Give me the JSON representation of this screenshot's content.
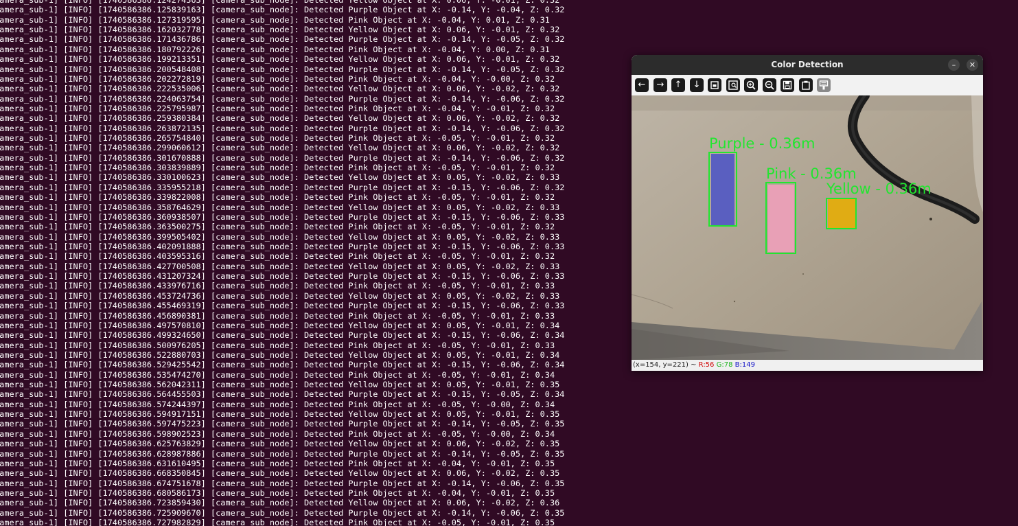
{
  "terminal": {
    "lines": [
      "camera_sub-1] [INFO] [1740586386.124274363] [camera_sub_node]: Detected Yellow Object at X: 0.06, Y: -0.01, Z: 0.32",
      "camera_sub-1] [INFO] [1740586386.125839163] [camera_sub_node]: Detected Purple Object at X: -0.14, Y: -0.04, Z: 0.32",
      "camera_sub-1] [INFO] [1740586386.127319595] [camera_sub_node]: Detected Pink Object at X: -0.04, Y: 0.01, Z: 0.31",
      "camera_sub-1] [INFO] [1740586386.162032778] [camera_sub_node]: Detected Yellow Object at X: 0.06, Y: -0.01, Z: 0.32",
      "camera_sub-1] [INFO] [1740586386.171436786] [camera_sub_node]: Detected Purple Object at X: -0.14, Y: -0.05, Z: 0.32",
      "camera_sub-1] [INFO] [1740586386.180792226] [camera_sub_node]: Detected Pink Object at X: -0.04, Y: 0.00, Z: 0.31",
      "camera_sub-1] [INFO] [1740586386.199213351] [camera_sub_node]: Detected Yellow Object at X: 0.06, Y: -0.01, Z: 0.32",
      "camera_sub-1] [INFO] [1740586386.200548408] [camera_sub_node]: Detected Purple Object at X: -0.14, Y: -0.05, Z: 0.32",
      "camera_sub-1] [INFO] [1740586386.202272819] [camera_sub_node]: Detected Pink Object at X: -0.04, Y: -0.00, Z: 0.32",
      "camera_sub-1] [INFO] [1740586386.222535006] [camera_sub_node]: Detected Yellow Object at X: 0.06, Y: -0.02, Z: 0.32",
      "camera_sub-1] [INFO] [1740586386.224063754] [camera_sub_node]: Detected Purple Object at X: -0.14, Y: -0.06, Z: 0.32",
      "camera_sub-1] [INFO] [1740586386.225795987] [camera_sub_node]: Detected Pink Object at X: -0.04, Y: -0.01, Z: 0.32",
      "camera_sub-1] [INFO] [1740586386.259380384] [camera_sub_node]: Detected Yellow Object at X: 0.06, Y: -0.02, Z: 0.32",
      "camera_sub-1] [INFO] [1740586386.263872135] [camera_sub_node]: Detected Purple Object at X: -0.14, Y: -0.06, Z: 0.32",
      "camera_sub-1] [INFO] [1740586386.265754840] [camera_sub_node]: Detected Pink Object at X: -0.05, Y: -0.01, Z: 0.32",
      "camera_sub-1] [INFO] [1740586386.299060612] [camera_sub_node]: Detected Yellow Object at X: 0.06, Y: -0.02, Z: 0.32",
      "camera_sub-1] [INFO] [1740586386.301670888] [camera_sub_node]: Detected Purple Object at X: -0.14, Y: -0.06, Z: 0.32",
      "camera_sub-1] [INFO] [1740586386.303839889] [camera_sub_node]: Detected Pink Object at X: -0.05, Y: -0.01, Z: 0.32",
      "camera_sub-1] [INFO] [1740586386.330100623] [camera_sub_node]: Detected Yellow Object at X: 0.05, Y: -0.02, Z: 0.33",
      "camera_sub-1] [INFO] [1740586386.335955218] [camera_sub_node]: Detected Purple Object at X: -0.15, Y: -0.06, Z: 0.32",
      "camera_sub-1] [INFO] [1740586386.339822008] [camera_sub_node]: Detected Pink Object at X: -0.05, Y: -0.01, Z: 0.32",
      "camera_sub-1] [INFO] [1740586386.358764629] [camera_sub_node]: Detected Yellow Object at X: 0.05, Y: -0.02, Z: 0.33",
      "camera_sub-1] [INFO] [1740586386.360938507] [camera_sub_node]: Detected Purple Object at X: -0.15, Y: -0.06, Z: 0.33",
      "camera_sub-1] [INFO] [1740586386.363500275] [camera_sub_node]: Detected Pink Object at X: -0.05, Y: -0.01, Z: 0.32",
      "camera_sub-1] [INFO] [1740586386.399505402] [camera_sub_node]: Detected Yellow Object at X: 0.05, Y: -0.02, Z: 0.33",
      "camera_sub-1] [INFO] [1740586386.402091888] [camera_sub_node]: Detected Purple Object at X: -0.15, Y: -0.06, Z: 0.33",
      "camera_sub-1] [INFO] [1740586386.403595316] [camera_sub_node]: Detected Pink Object at X: -0.05, Y: -0.01, Z: 0.32",
      "camera_sub-1] [INFO] [1740586386.427700508] [camera_sub_node]: Detected Yellow Object at X: 0.05, Y: -0.02, Z: 0.33",
      "camera_sub-1] [INFO] [1740586386.431207324] [camera_sub_node]: Detected Purple Object at X: -0.15, Y: -0.06, Z: 0.33",
      "camera_sub-1] [INFO] [1740586386.433976716] [camera_sub_node]: Detected Pink Object at X: -0.05, Y: -0.01, Z: 0.33",
      "camera_sub-1] [INFO] [1740586386.453724736] [camera_sub_node]: Detected Yellow Object at X: 0.05, Y: -0.02, Z: 0.33",
      "camera_sub-1] [INFO] [1740586386.455469319] [camera_sub_node]: Detected Purple Object at X: -0.15, Y: -0.06, Z: 0.33",
      "camera_sub-1] [INFO] [1740586386.456890381] [camera_sub_node]: Detected Pink Object at X: -0.05, Y: -0.01, Z: 0.33",
      "camera_sub-1] [INFO] [1740586386.497570810] [camera_sub_node]: Detected Yellow Object at X: 0.05, Y: -0.01, Z: 0.34",
      "camera_sub-1] [INFO] [1740586386.499324650] [camera_sub_node]: Detected Purple Object at X: -0.15, Y: -0.06, Z: 0.34",
      "camera_sub-1] [INFO] [1740586386.500976205] [camera_sub_node]: Detected Pink Object at X: -0.05, Y: -0.01, Z: 0.33",
      "camera_sub-1] [INFO] [1740586386.522880703] [camera_sub_node]: Detected Yellow Object at X: 0.05, Y: -0.01, Z: 0.34",
      "camera_sub-1] [INFO] [1740586386.529425542] [camera_sub_node]: Detected Purple Object at X: -0.15, Y: -0.06, Z: 0.34",
      "camera_sub-1] [INFO] [1740586386.535474270] [camera_sub_node]: Detected Pink Object at X: -0.05, Y: -0.01, Z: 0.34",
      "camera_sub-1] [INFO] [1740586386.562042311] [camera_sub_node]: Detected Yellow Object at X: 0.05, Y: -0.01, Z: 0.35",
      "camera_sub-1] [INFO] [1740586386.564455503] [camera_sub_node]: Detected Purple Object at X: -0.15, Y: -0.05, Z: 0.34",
      "camera_sub-1] [INFO] [1740586386.574244397] [camera_sub_node]: Detected Pink Object at X: -0.05, Y: -0.00, Z: 0.34",
      "camera_sub-1] [INFO] [1740586386.594917151] [camera_sub_node]: Detected Yellow Object at X: 0.05, Y: -0.01, Z: 0.35",
      "camera_sub-1] [INFO] [1740586386.597475223] [camera_sub_node]: Detected Purple Object at X: -0.14, Y: -0.05, Z: 0.35",
      "camera_sub-1] [INFO] [1740586386.598902523] [camera_sub_node]: Detected Pink Object at X: -0.05, Y: -0.00, Z: 0.34",
      "camera_sub-1] [INFO] [1740586386.625763829] [camera_sub_node]: Detected Yellow Object at X: 0.06, Y: -0.02, Z: 0.35",
      "camera_sub-1] [INFO] [1740586386.628987886] [camera_sub_node]: Detected Purple Object at X: -0.14, Y: -0.05, Z: 0.35",
      "camera_sub-1] [INFO] [1740586386.631610495] [camera_sub_node]: Detected Pink Object at X: -0.04, Y: -0.01, Z: 0.35",
      "camera_sub-1] [INFO] [1740586386.668350845] [camera_sub_node]: Detected Yellow Object at X: 0.06, Y: -0.02, Z: 0.35",
      "camera_sub-1] [INFO] [1740586386.674751678] [camera_sub_node]: Detected Purple Object at X: -0.14, Y: -0.06, Z: 0.35",
      "camera_sub-1] [INFO] [1740586386.680586173] [camera_sub_node]: Detected Pink Object at X: -0.04, Y: -0.01, Z: 0.35",
      "camera_sub-1] [INFO] [1740586386.723859430] [camera_sub_node]: Detected Yellow Object at X: 0.06, Y: -0.02, Z: 0.36",
      "camera_sub-1] [INFO] [1740586386.725909670] [camera_sub_node]: Detected Purple Object at X: -0.14, Y: -0.06, Z: 0.35",
      "camera_sub-1] [INFO] [1740586386.727982829] [camera_sub_node]: Detected Pink Object at X: -0.05, Y: -0.01, Z: 0.35"
    ]
  },
  "window": {
    "title": "Color Detection",
    "minimize_glyph": "–",
    "close_glyph": "✕",
    "toolbar": [
      {
        "icon": "arrow-left-icon",
        "glyph": "←"
      },
      {
        "icon": "arrow-right-icon",
        "glyph": "→"
      },
      {
        "icon": "arrow-up-icon",
        "glyph": "↑"
      },
      {
        "icon": "arrow-down-icon",
        "glyph": "↓"
      },
      {
        "icon": "zoom-fit-icon",
        "glyph": ""
      },
      {
        "icon": "zoom-original-icon",
        "glyph": ""
      },
      {
        "icon": "zoom-in-icon",
        "glyph": ""
      },
      {
        "icon": "zoom-out-icon",
        "glyph": ""
      },
      {
        "icon": "save-icon",
        "glyph": ""
      },
      {
        "icon": "copy-icon",
        "glyph": ""
      },
      {
        "icon": "properties-icon",
        "glyph": ""
      }
    ],
    "detections": [
      {
        "label": "Purple - 0.36m",
        "color": "#5a5fc0"
      },
      {
        "label": "Pink - 0.36m",
        "color": "#e8a0b6"
      },
      {
        "label": "Yellow - 0.36m",
        "color": "#e0ac14"
      }
    ],
    "box_color": "#21e62f",
    "status": {
      "coords": "(x=154, y=221) ~ ",
      "r": "R:56",
      "g": "G:78",
      "b": "B:149"
    }
  }
}
